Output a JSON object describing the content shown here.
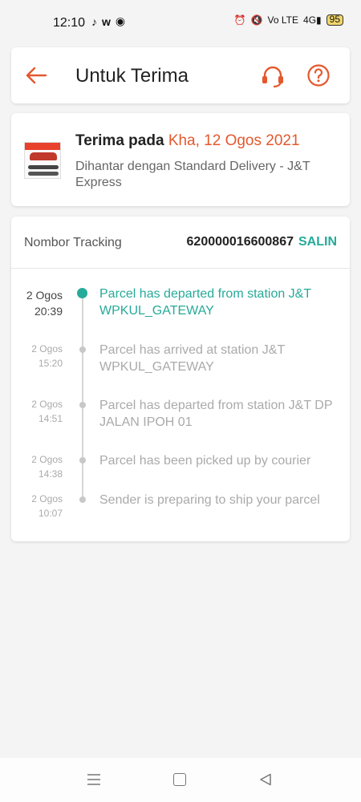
{
  "status_bar": {
    "time": "12:10",
    "left_icons": [
      "tiktok-icon",
      "w-icon",
      "m-icon"
    ],
    "right_icons": [
      "alarm-icon",
      "mute-icon",
      "volte-icon",
      "4g-signal-icon"
    ],
    "volte_label": "Vo LTE",
    "network_label": "4G",
    "battery": "95"
  },
  "header": {
    "title": "Untuk Terima",
    "accent_color": "#e4582d"
  },
  "delivery": {
    "receive_prefix": "Terima pada ",
    "receive_date": "Kha, 12 Ogos 2021",
    "method": "Dihantar dengan Standard Delivery  - J&T Express"
  },
  "tracking": {
    "label": "Nombor Tracking",
    "number": "620000016600867",
    "copy_label": "SALIN",
    "events": [
      {
        "date": "2 Ogos",
        "time": "20:39",
        "text": "Parcel has departed from station J&T WPKUL_GATEWAY"
      },
      {
        "date": "2 Ogos",
        "time": "15:20",
        "text": "Parcel has arrived at station J&T WPKUL_GATEWAY"
      },
      {
        "date": "2 Ogos",
        "time": "14:51",
        "text": "Parcel has departed from station J&T DP JALAN IPOH 01"
      },
      {
        "date": "2 Ogos",
        "time": "14:38",
        "text": "Parcel has been picked up by courier"
      },
      {
        "date": "2 Ogos",
        "time": "10:07",
        "text": "Sender is preparing to ship your parcel"
      }
    ],
    "active_color": "#26aa99"
  },
  "nav_bar": {
    "icons": [
      "menu-icon",
      "home-icon",
      "back-triangle-icon"
    ]
  }
}
